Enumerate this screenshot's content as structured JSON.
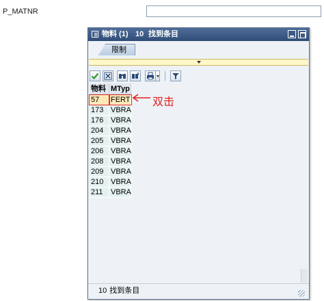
{
  "background_screen": {
    "field_label": "P_MATNR",
    "field_value": ""
  },
  "popup": {
    "title": "物料 (1)",
    "title_count": "10",
    "title_found": "找到条目",
    "tabs": [
      {
        "label": "限制"
      }
    ],
    "toolbar": {
      "buttons": [
        {
          "icon": "checkmark-icon"
        },
        {
          "icon": "cancel-icon"
        },
        {
          "icon": "find-icon"
        },
        {
          "icon": "find-next-icon"
        },
        {
          "icon": "print-icon"
        },
        {
          "icon": "filter-icon"
        }
      ]
    },
    "table": {
      "columns": [
        "物料",
        "MTyp"
      ],
      "rows": [
        {
          "material": "57",
          "mtyp": "FERT"
        },
        {
          "material": "173",
          "mtyp": "VBRA"
        },
        {
          "material": "176",
          "mtyp": "VBRA"
        },
        {
          "material": "204",
          "mtyp": "VBRA"
        },
        {
          "material": "205",
          "mtyp": "VBRA"
        },
        {
          "material": "206",
          "mtyp": "VBRA"
        },
        {
          "material": "208",
          "mtyp": "VBRA"
        },
        {
          "material": "209",
          "mtyp": "VBRA"
        },
        {
          "material": "210",
          "mtyp": "VBRA"
        },
        {
          "material": "211",
          "mtyp": "VBRA"
        }
      ]
    },
    "status": {
      "count": "10",
      "text": "找到条目"
    }
  },
  "annotation": {
    "text": "双击",
    "color": "#e21f1f"
  },
  "colors": {
    "titlebar": "#3d5a85",
    "row_background": "#e4f1f0",
    "selected_row": "#fde8b8",
    "highlight_border": "#e52b2b"
  }
}
